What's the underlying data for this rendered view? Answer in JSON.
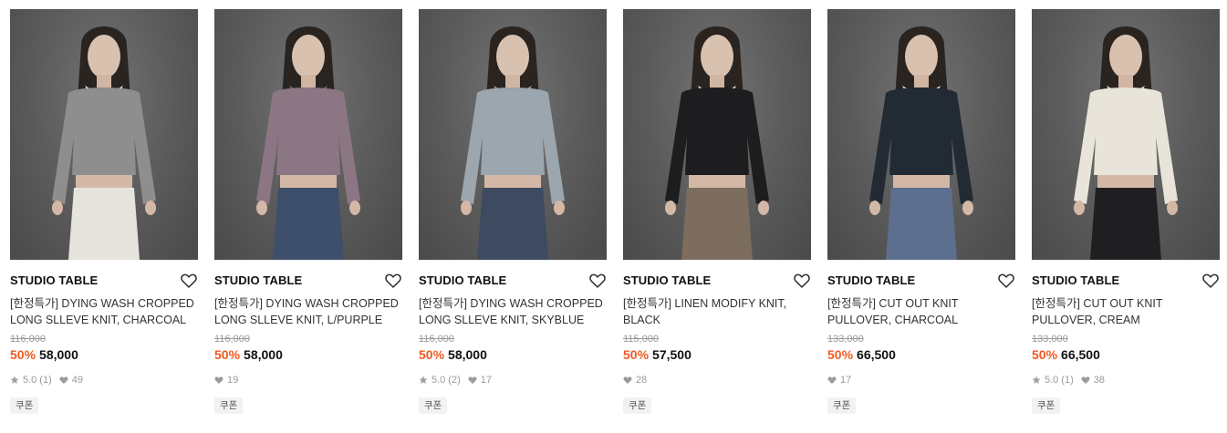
{
  "products": [
    {
      "brand": "STUDIO TABLE",
      "title": "[한정특가] DYING WASH CROPPED LONG SLLEVE KNIT, CHARCOAL",
      "original_price": "116,000",
      "discount": "50%",
      "price": "58,000",
      "rating": "5.0",
      "review_count": "(1)",
      "likes": "49",
      "badge": "쿠폰",
      "image_colors": {
        "top": "#8e8e8e",
        "bottom": "#e7e3dd",
        "collar": "#efeeee"
      }
    },
    {
      "brand": "STUDIO TABLE",
      "title": "[한정특가] DYING WASH CROPPED LONG SLLEVE KNIT, L/PURPLE",
      "original_price": "116,000",
      "discount": "50%",
      "price": "58,000",
      "rating": "",
      "review_count": "",
      "likes": "19",
      "badge": "쿠폰",
      "image_colors": {
        "top": "#8d7684",
        "bottom": "#3d4f6b",
        "collar": "#6d6b62"
      }
    },
    {
      "brand": "STUDIO TABLE",
      "title": "[한정특가] DYING WASH CROPPED LONG SLLEVE KNIT, SKYBLUE",
      "original_price": "116,000",
      "discount": "50%",
      "price": "58,000",
      "rating": "5.0",
      "review_count": "(2)",
      "likes": "17",
      "badge": "쿠폰",
      "image_colors": {
        "top": "#9ba6ae",
        "bottom": "#3d4a60",
        "collar": "#9ba6ae"
      }
    },
    {
      "brand": "STUDIO TABLE",
      "title": "[한정특가] LINEN MODIFY KNIT, BLACK",
      "original_price": "115,000",
      "discount": "50%",
      "price": "57,500",
      "rating": "",
      "review_count": "",
      "likes": "28",
      "badge": "쿠폰",
      "image_colors": {
        "top": "#1d1d1f",
        "bottom": "#7c6d5e",
        "collar": "#f2f2f2"
      }
    },
    {
      "brand": "STUDIO TABLE",
      "title": "[한정특가] CUT OUT KNIT PULLOVER, CHARCOAL",
      "original_price": "133,000",
      "discount": "50%",
      "price": "66,500",
      "rating": "",
      "review_count": "",
      "likes": "17",
      "badge": "쿠폰",
      "image_colors": {
        "top": "#222a33",
        "bottom": "#5d6f8e",
        "collar": "#f0f0ee"
      }
    },
    {
      "brand": "STUDIO TABLE",
      "title": "[한정특가] CUT OUT KNIT PULLOVER, CREAM",
      "original_price": "133,000",
      "discount": "50%",
      "price": "66,500",
      "rating": "5.0",
      "review_count": "(1)",
      "likes": "38",
      "badge": "쿠폰",
      "image_colors": {
        "top": "#e8e4da",
        "bottom": "#1f1f21",
        "collar": "#e8e4da"
      }
    }
  ],
  "icons": {
    "wishlist": "heart-outline-icon",
    "rating": "star-icon",
    "likes": "heart-filled-icon"
  },
  "colors": {
    "discount": "#f15a22",
    "meta": "#9a9a9a",
    "badge_bg": "#f2f2f2"
  }
}
